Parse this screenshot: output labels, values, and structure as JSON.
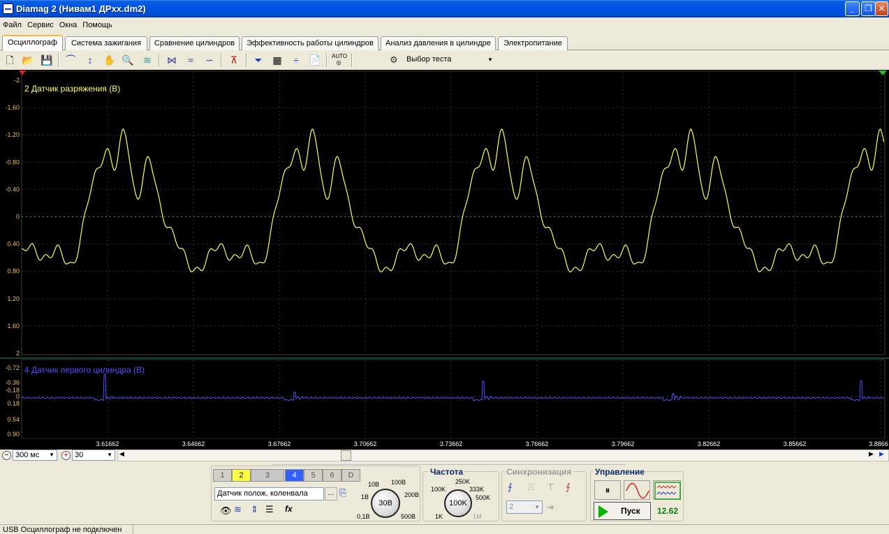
{
  "window": {
    "title": "Diamag 2 (Нивам1 ДРхх.dm2)",
    "minimize_label": "_",
    "maximize_label": "❐",
    "close_label": "✕"
  },
  "menu": [
    "Файл",
    "Сервис",
    "Окна",
    "Помощь"
  ],
  "tabs": [
    "Осциллограф",
    "Система зажигания",
    "Сравнение цилиндров",
    "Эффективность работы цилиндров",
    "Анализ давления в цилиндре",
    "Электропитание"
  ],
  "active_tab": "Осциллограф",
  "toolbar": {
    "test_select_label": "Выбор теста",
    "auto_label": "AUTO"
  },
  "channel_top": {
    "label": "2 Датчик разряжения (В)",
    "color": "#ffff50",
    "y_ticks": [
      "-2",
      "-1.60",
      "-1.20",
      "-0.80",
      "-0.40",
      "0",
      "0.40",
      "0.80",
      "1.20",
      "1.60",
      "2"
    ]
  },
  "channel_bottom": {
    "label": "4 Датчик первого цилиндра (В)",
    "color": "#5050ff",
    "y_ticks": [
      "-0.72",
      "-0.36",
      "-0.18",
      "0",
      "0.18",
      "0.54",
      "0.90"
    ]
  },
  "time_axis": {
    "ticks": [
      "3.61662",
      "3.64662",
      "3.67662",
      "3.70662",
      "3.73662",
      "3.76662",
      "3.79662",
      "3.82662",
      "3.85662",
      "3.8866"
    ]
  },
  "zoom": {
    "time_scale": "300 мс",
    "zoom_value": "30"
  },
  "channels_panel": {
    "buttons": [
      "1",
      "2",
      "3",
      "4",
      "5",
      "6",
      "D"
    ],
    "sensor": "Датчик полож. коленвала",
    "fx_label": "fx"
  },
  "voltage_knob": {
    "value": "30В",
    "labels": [
      "10В",
      "100В",
      "1В",
      "200В",
      "0,1В",
      "500В"
    ]
  },
  "frequency": {
    "title": "Частота",
    "value": "100K",
    "labels": [
      "250K",
      "100K",
      "333K",
      "500K",
      "1K",
      "1M"
    ]
  },
  "sync": {
    "title": "Синхронизация",
    "channel_value": "2"
  },
  "control": {
    "title": "Управление",
    "start_label": "Пуск",
    "timer": "12.62"
  },
  "status": {
    "text": "USB Осциллограф не подключен"
  }
}
